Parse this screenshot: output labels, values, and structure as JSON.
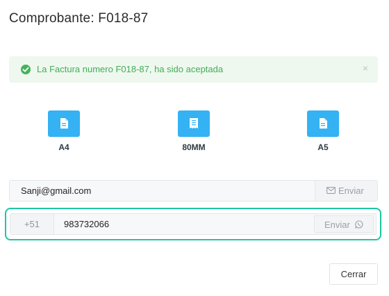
{
  "modal": {
    "title": "Comprobante: F018-87"
  },
  "alert": {
    "message": "La Factura numero F018-87, ha sido aceptada",
    "close_symbol": "×",
    "icon": "check-circle-icon",
    "color": "#44ad57",
    "background": "#eef8ef"
  },
  "formats": [
    {
      "label": "A4",
      "icon": "document-icon"
    },
    {
      "label": "80MM",
      "icon": "receipt-icon"
    },
    {
      "label": "A5",
      "icon": "document-icon"
    }
  ],
  "email": {
    "value": "Sanji@gmail.com",
    "send_label": "Enviar",
    "icon": "envelope-icon"
  },
  "whatsapp": {
    "prefix": "+51",
    "number": "983732066",
    "send_label": "Enviar",
    "icon": "whatsapp-icon"
  },
  "footer": {
    "close_label": "Cerrar"
  },
  "colors": {
    "accent": "#34b2f3",
    "focus": "#1cc6a3"
  }
}
